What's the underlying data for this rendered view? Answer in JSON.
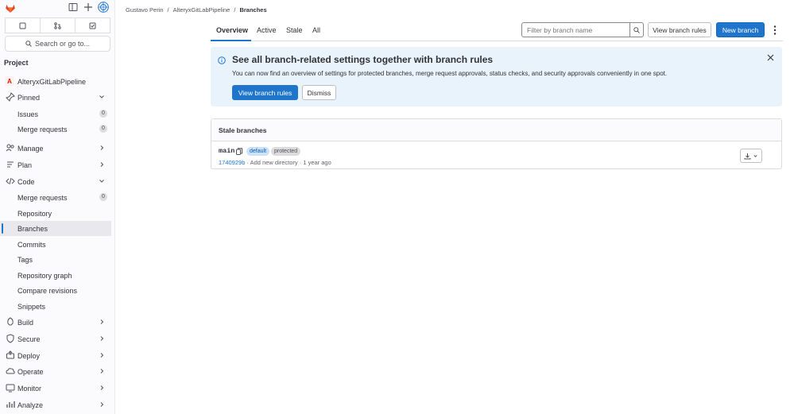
{
  "sidebar": {
    "search_label": "Search or go to...",
    "section_title": "Project",
    "project_initial": "A",
    "project_name": "AlteryxGitLabPipeline",
    "items": [
      {
        "label": "Pinned",
        "kind": "group-open"
      },
      {
        "label": "Issues",
        "count": "0"
      },
      {
        "label": "Merge requests",
        "count": "0"
      },
      {
        "label": "Manage"
      },
      {
        "label": "Plan"
      },
      {
        "label": "Code",
        "kind": "group-open"
      },
      {
        "label": "Merge requests",
        "count": "0"
      },
      {
        "label": "Repository"
      },
      {
        "label": "Branches",
        "active": true
      },
      {
        "label": "Commits"
      },
      {
        "label": "Tags"
      },
      {
        "label": "Repository graph"
      },
      {
        "label": "Compare revisions"
      },
      {
        "label": "Snippets"
      },
      {
        "label": "Build"
      },
      {
        "label": "Secure"
      },
      {
        "label": "Deploy"
      },
      {
        "label": "Operate"
      },
      {
        "label": "Monitor"
      },
      {
        "label": "Analyze"
      }
    ]
  },
  "breadcrumb": {
    "user": "Gustavo Perin",
    "sep": "/",
    "project": "AlteryxGitLabPipeline",
    "current": "Branches"
  },
  "tabs": {
    "overview": "Overview",
    "active": "Active",
    "stale": "Stale",
    "all": "All"
  },
  "filter": {
    "placeholder": "Filter by branch name"
  },
  "actions": {
    "view_rules": "View branch rules",
    "new_branch": "New branch"
  },
  "alert": {
    "title": "See all branch-related settings together with branch rules",
    "body": "You can now find an overview of settings for protected branches, merge request approvals, status checks, and security approvals conveniently in one spot.",
    "primary": "View branch rules",
    "secondary": "Dismiss"
  },
  "stale": {
    "heading": "Stale branches",
    "branch": {
      "name": "main",
      "badge_default": "default",
      "badge_protected": "protected",
      "sha": "1740929b",
      "message": "· Add new directory · 1 year ago"
    }
  },
  "colors": {
    "accent": "#1f75cb",
    "alert_bg": "#e9f3fc",
    "brand": "#e24329"
  }
}
